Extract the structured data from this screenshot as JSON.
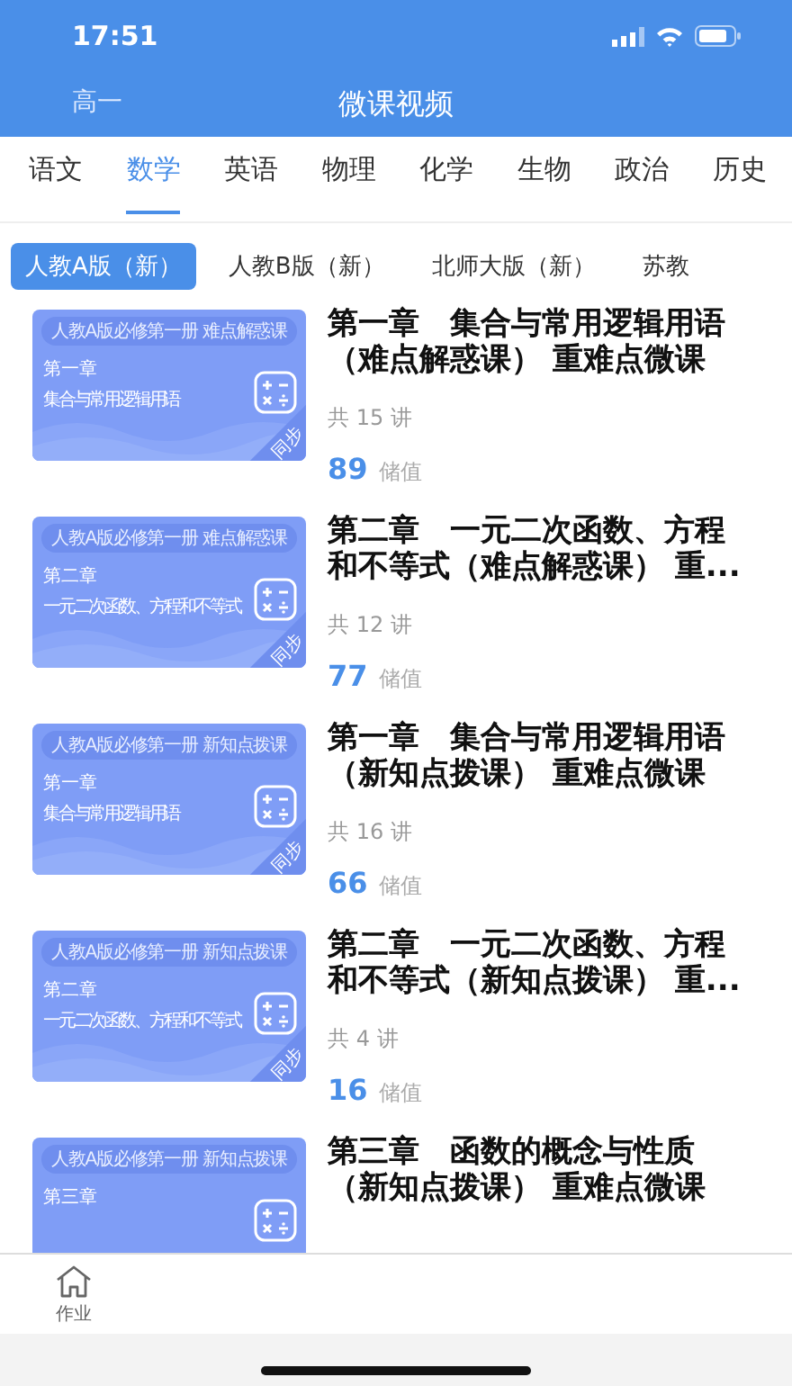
{
  "status_bar": {
    "time": "17:51"
  },
  "nav": {
    "left": "高一",
    "title": "微课视频"
  },
  "subjects": [
    {
      "label": "语文",
      "selected": false
    },
    {
      "label": "数学",
      "selected": true
    },
    {
      "label": "英语",
      "selected": false
    },
    {
      "label": "物理",
      "selected": false
    },
    {
      "label": "化学",
      "selected": false
    },
    {
      "label": "生物",
      "selected": false
    },
    {
      "label": "政治",
      "selected": false
    },
    {
      "label": "历史",
      "selected": false
    }
  ],
  "editions": [
    {
      "label": "人教A版（新）",
      "selected": true
    },
    {
      "label": "人教B版（新）",
      "selected": false
    },
    {
      "label": "北师大版（新）",
      "selected": false
    },
    {
      "label": "苏教",
      "selected": false
    }
  ],
  "courses": [
    {
      "cover": {
        "badge": "人教A版必修第一册  难点解惑课",
        "chapter": "第一章",
        "name": "集合与常用逻辑用语",
        "corner": "同步"
      },
      "title": "第一章　集合与常用逻辑用语（难点解惑课） 重难点微课",
      "count": "共 15 讲",
      "price": "89",
      "unit": "储值"
    },
    {
      "cover": {
        "badge": "人教A版必修第一册  难点解惑课",
        "chapter": "第二章",
        "name": "一元二次函数、方程和不等式",
        "corner": "同步"
      },
      "title": "第二章　一元二次函数、方程和不等式（难点解惑课） 重...",
      "count": "共 12 讲",
      "price": "77",
      "unit": "储值"
    },
    {
      "cover": {
        "badge": "人教A版必修第一册  新知点拨课",
        "chapter": "第一章",
        "name": "集合与常用逻辑用语",
        "corner": "同步"
      },
      "title": "第一章　集合与常用逻辑用语（新知点拨课） 重难点微课",
      "count": "共 16 讲",
      "price": "66",
      "unit": "储值"
    },
    {
      "cover": {
        "badge": "人教A版必修第一册  新知点拨课",
        "chapter": "第二章",
        "name": "一元二次函数、方程和不等式",
        "corner": "同步"
      },
      "title": "第二章　一元二次函数、方程和不等式（新知点拨课） 重...",
      "count": "共 4 讲",
      "price": "16",
      "unit": "储值"
    },
    {
      "cover": {
        "badge": "人教A版必修第一册  新知点拨课",
        "chapter": "第三章"
      },
      "title": "第三章　函数的概念与性质（新知点拨课） 重难点微课"
    }
  ],
  "tab_bar": [
    {
      "label": "作业",
      "selected": false
    }
  ]
}
